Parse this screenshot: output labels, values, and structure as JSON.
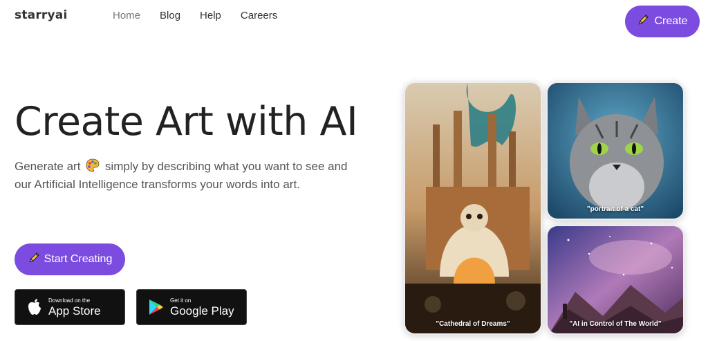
{
  "brand": {
    "logo_text": "starryai"
  },
  "nav": {
    "items": [
      {
        "label": "Home",
        "active": true
      },
      {
        "label": "Blog"
      },
      {
        "label": "Help"
      },
      {
        "label": "Careers"
      }
    ],
    "create_label": "Create"
  },
  "hero": {
    "title": "Create Art with AI",
    "subtitle_part1": "Generate art",
    "subtitle_part2": "simply by describing what you want to see and our Artificial Intelligence transforms your words into art.",
    "start_label": "Start Creating"
  },
  "stores": {
    "apple": {
      "small": "Download on the",
      "big": "App Store"
    },
    "google": {
      "small": "Get it on",
      "big": "Google Play"
    }
  },
  "gallery": {
    "captions": [
      "\"Cathedral of Dreams\"",
      "\"portrait of a cat\"",
      "\"AI in Control of The World\""
    ]
  },
  "colors": {
    "accent": "#7c4ce0"
  },
  "icons": [
    "pencil-icon",
    "palette-icon",
    "apple-icon",
    "google-play-icon"
  ]
}
